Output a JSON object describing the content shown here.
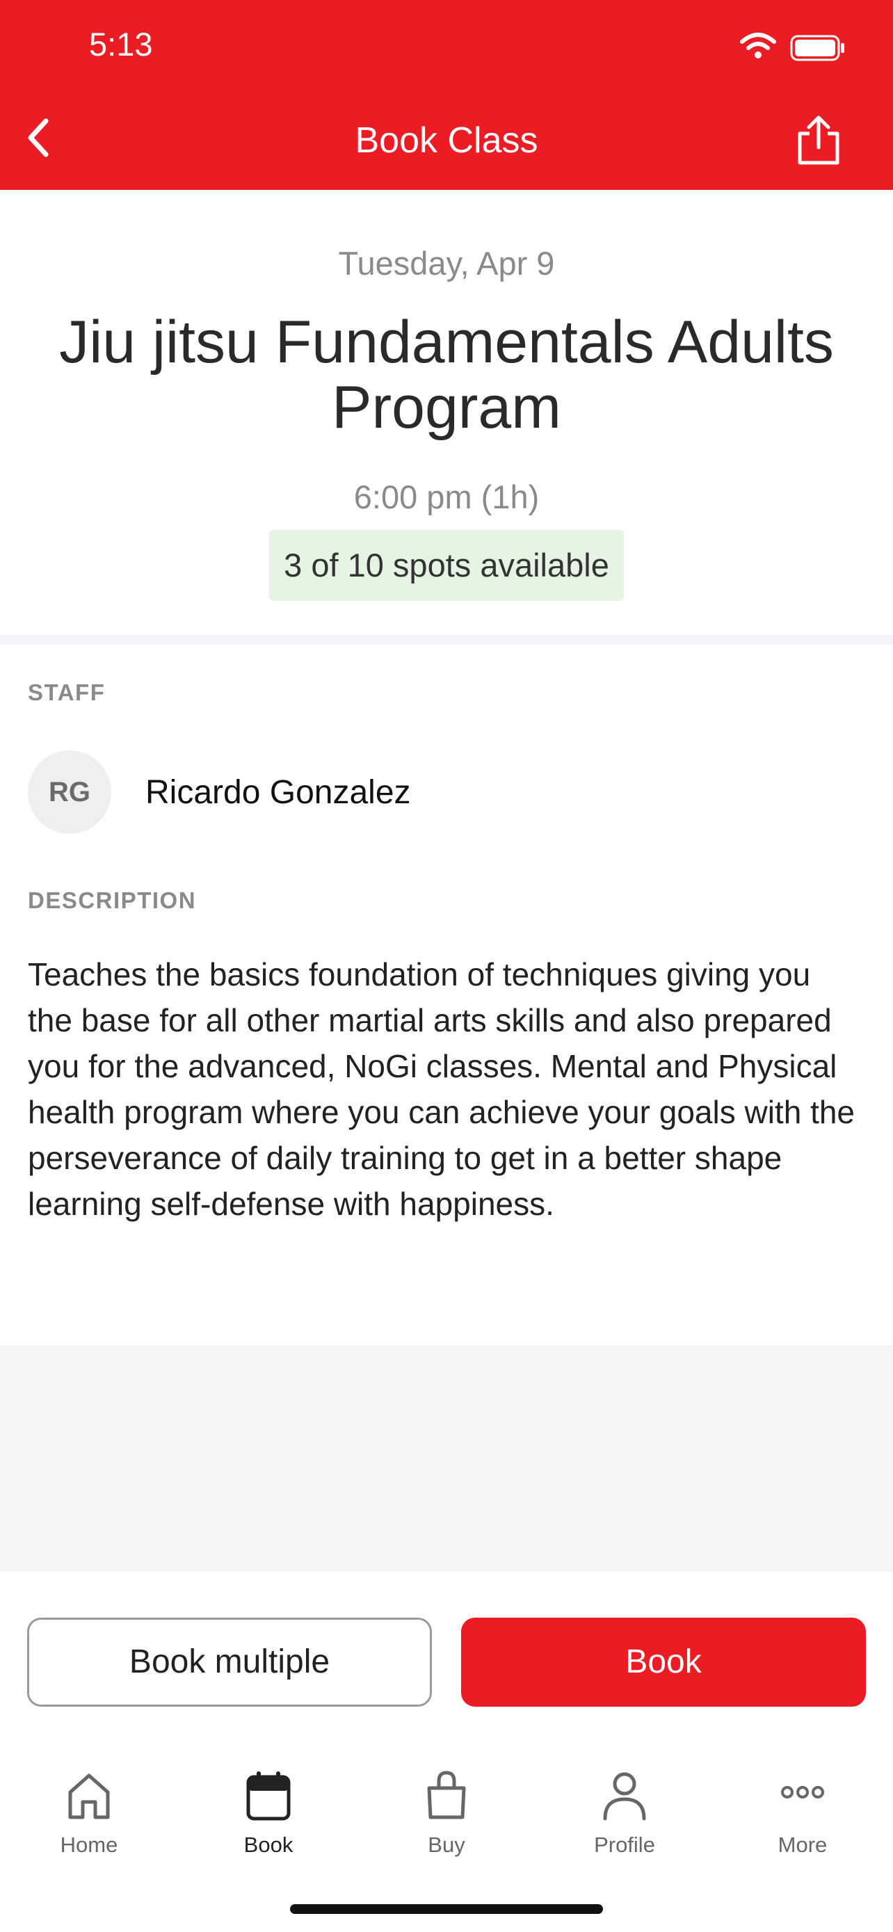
{
  "status_bar": {
    "time": "5:13"
  },
  "nav": {
    "title": "Book Class"
  },
  "class": {
    "date": "Tuesday, Apr 9",
    "title": "Jiu jitsu Fundamentals Adults Program",
    "time": "6:00 pm (1h)",
    "spots": "3 of 10 spots available"
  },
  "staff": {
    "section_label": "STAFF",
    "initials": "RG",
    "name": "Ricardo Gonzalez"
  },
  "description": {
    "section_label": "DESCRIPTION",
    "text": "Teaches the basics foundation of techniques giving you the base for all other martial arts skills and also prepared you for the advanced, NoGi classes. Mental and Physical health program where you can achieve your goals with the perseverance of daily training to get in a better shape learning self-defense with happiness."
  },
  "actions": {
    "book_multiple": "Book multiple",
    "book": "Book"
  },
  "tabbar": [
    {
      "label": "Home",
      "icon": "home-icon"
    },
    {
      "label": "Book",
      "icon": "calendar-icon",
      "active": true
    },
    {
      "label": "Buy",
      "icon": "shopping-bag-icon"
    },
    {
      "label": "Profile",
      "icon": "person-icon"
    },
    {
      "label": "More",
      "icon": "more-dots-icon"
    }
  ],
  "colors": {
    "brand": "#ec1c24",
    "spots_bg": "#e6f4e4"
  }
}
